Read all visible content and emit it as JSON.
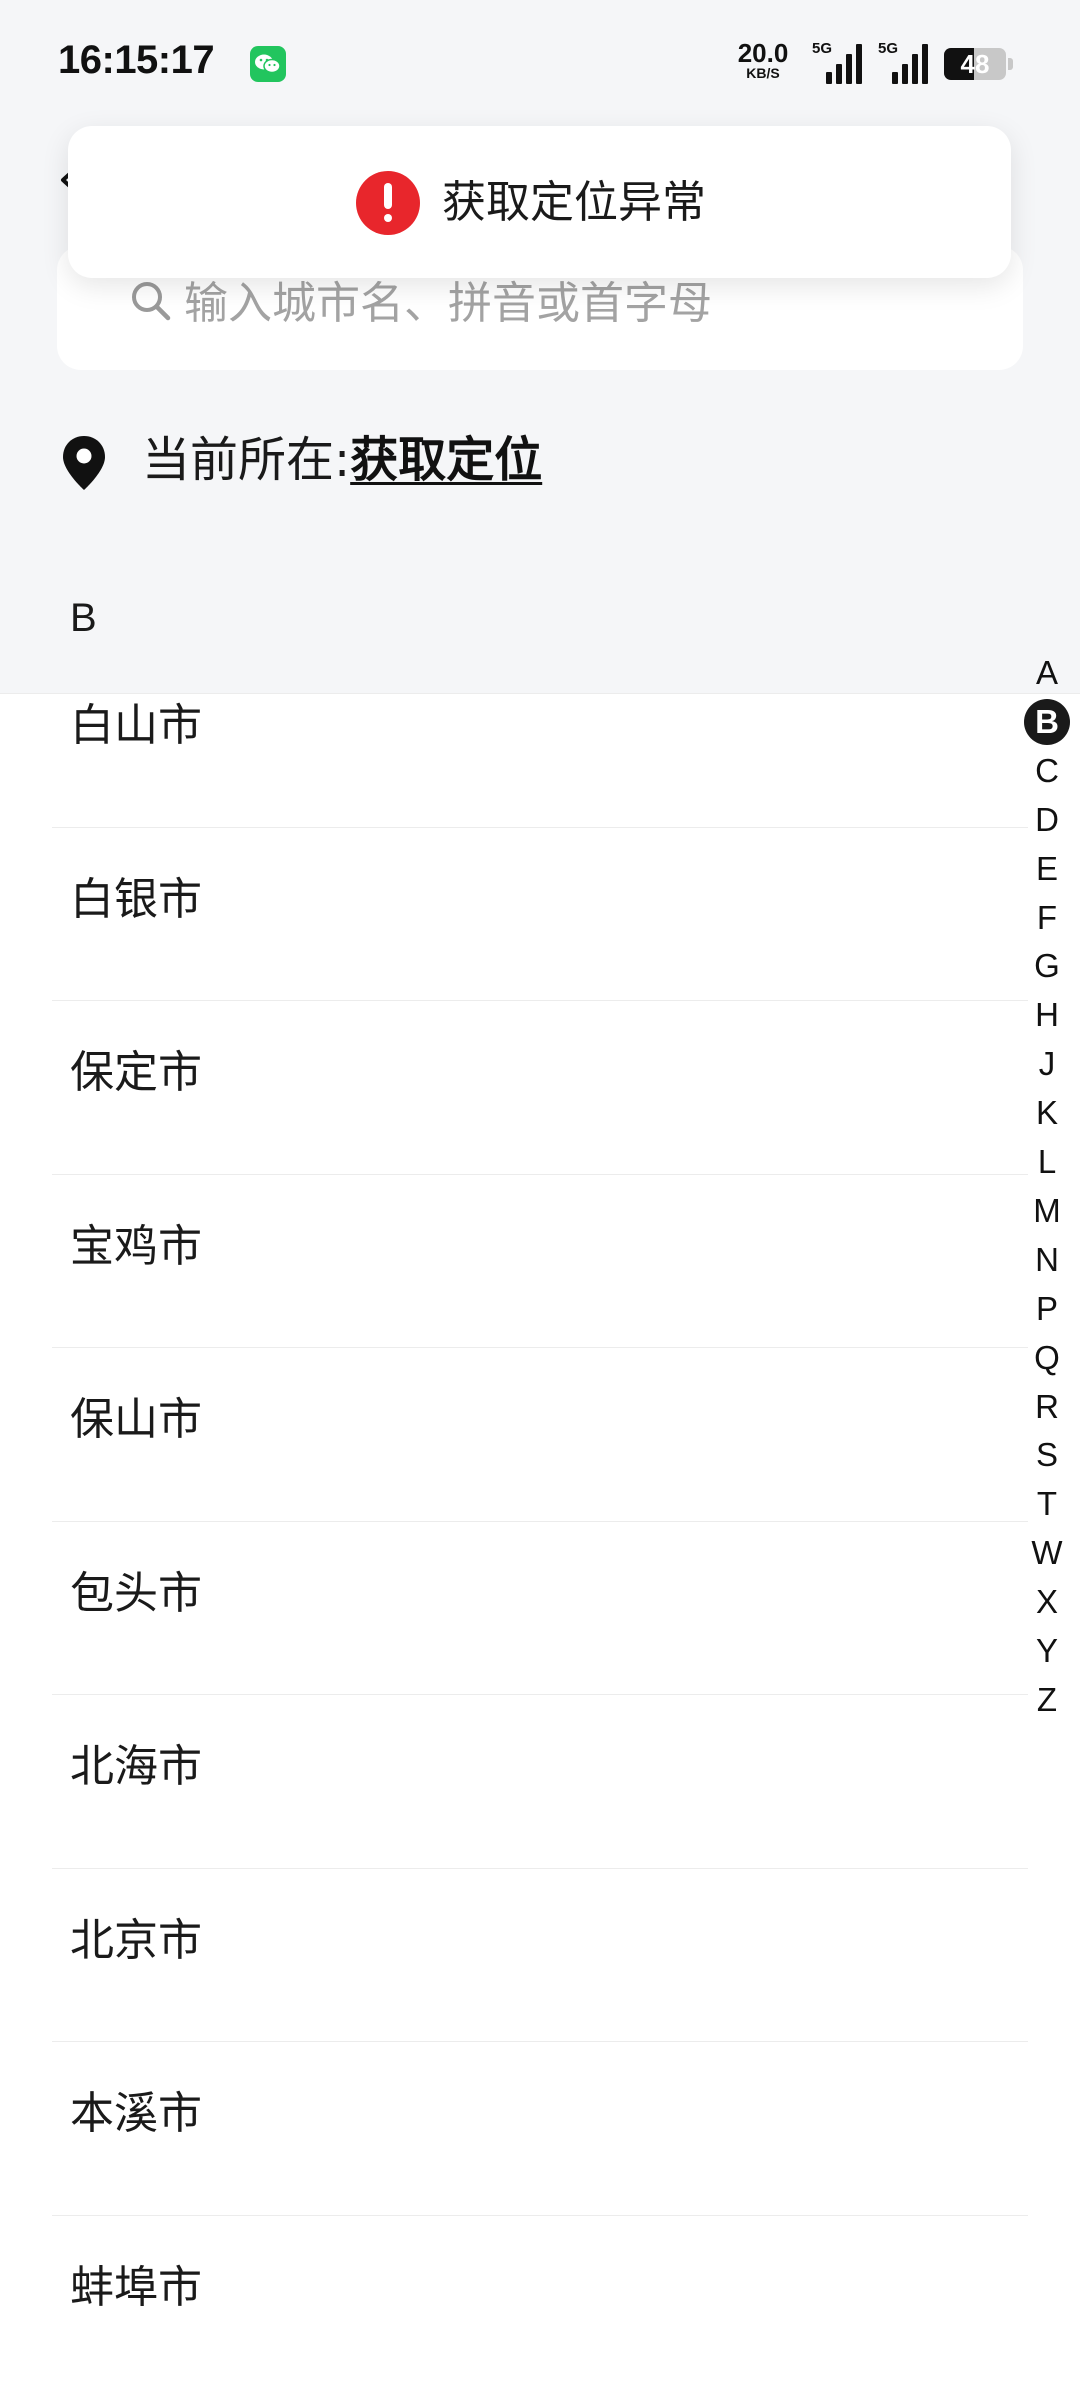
{
  "status_bar": {
    "time": "16:15:17",
    "net_speed_value": "20.0",
    "net_speed_unit": "KB/S",
    "signal_1_label": "5G",
    "signal_2_label": "5G",
    "battery_level": "48",
    "app_notification_icon": "wechat-icon"
  },
  "toast": {
    "icon": "error-icon",
    "message": "获取定位异常"
  },
  "search": {
    "icon": "search-icon",
    "placeholder": "输入城市名、拼音或首字母"
  },
  "location": {
    "icon": "location-pin-icon",
    "label": "当前所在:",
    "action": "获取定位"
  },
  "section": {
    "letter": "B"
  },
  "cities": [
    "白山市",
    "白银市",
    "保定市",
    "宝鸡市",
    "保山市",
    "包头市",
    "北海市",
    "北京市",
    "本溪市",
    "蚌埠市"
  ],
  "alphabet_index": {
    "letters": [
      "A",
      "B",
      "C",
      "D",
      "E",
      "F",
      "G",
      "H",
      "J",
      "K",
      "L",
      "M",
      "N",
      "P",
      "Q",
      "R",
      "S",
      "T",
      "W",
      "X",
      "Y",
      "Z"
    ],
    "active": "B"
  }
}
